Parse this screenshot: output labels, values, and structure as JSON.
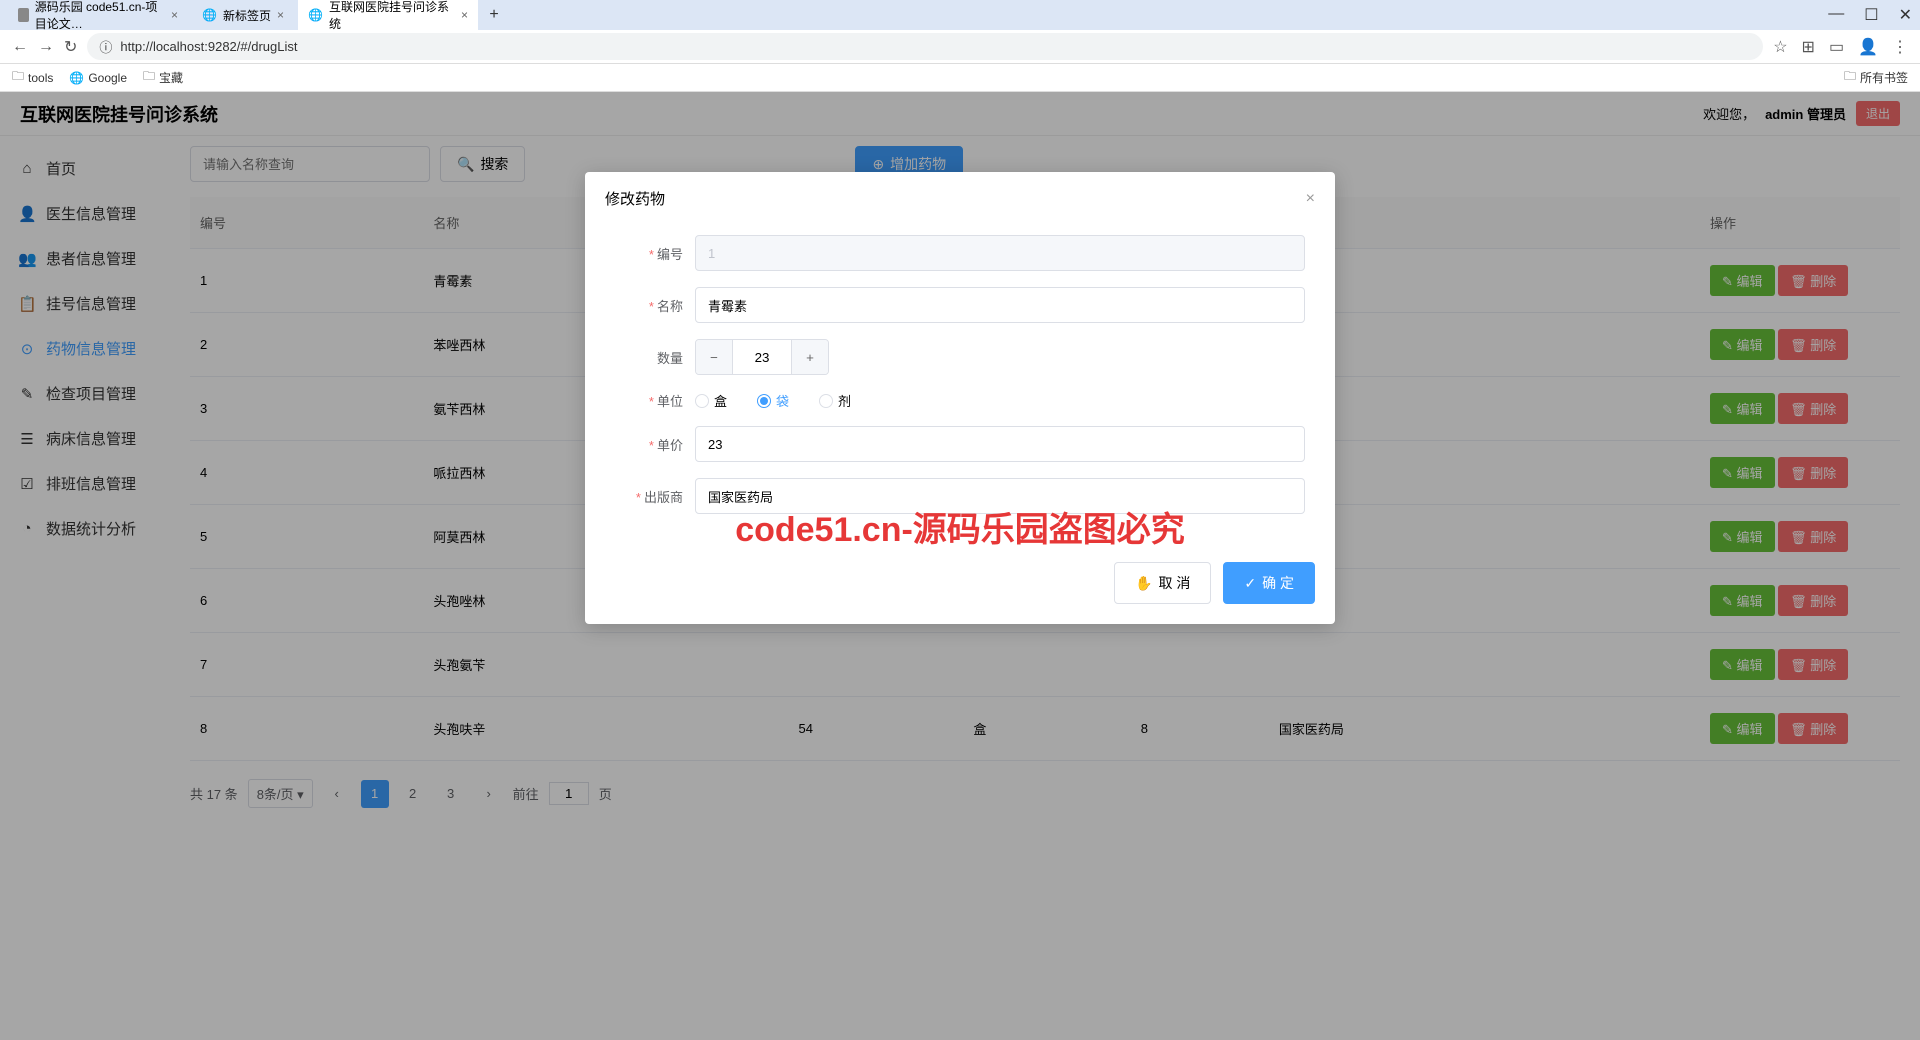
{
  "browser": {
    "tabs": [
      {
        "title": "源码乐园 code51.cn-项目论文…"
      },
      {
        "title": "新标签页"
      },
      {
        "title": "互联网医院挂号问诊系统"
      }
    ],
    "url": "http://localhost:9282/#/drugList",
    "bookmarks": [
      "tools",
      "Google",
      "宝藏"
    ],
    "all_bookmarks": "所有书签"
  },
  "header": {
    "title": "互联网医院挂号问诊系统",
    "welcome": "欢迎您，",
    "user": "admin 管理员",
    "logout": "退出"
  },
  "sidebar": {
    "items": [
      {
        "label": "首页",
        "icon": "⌂"
      },
      {
        "label": "医生信息管理",
        "icon": "👤"
      },
      {
        "label": "患者信息管理",
        "icon": "👥"
      },
      {
        "label": "挂号信息管理",
        "icon": "📋"
      },
      {
        "label": "药物信息管理",
        "icon": "⊙",
        "active": true
      },
      {
        "label": "检查项目管理",
        "icon": "✎"
      },
      {
        "label": "病床信息管理",
        "icon": "☰"
      },
      {
        "label": "排班信息管理",
        "icon": "☑"
      },
      {
        "label": "数据统计分析",
        "icon": "◔"
      }
    ]
  },
  "toolbar": {
    "search_placeholder": "请输入名称查询",
    "search_btn": "搜索",
    "add_btn": "增加药物"
  },
  "table": {
    "headers": [
      "编号",
      "名称",
      "",
      "",
      "",
      "",
      "操作"
    ],
    "edit": "编辑",
    "delete": "删除",
    "rows": [
      {
        "id": "1",
        "name": "青霉素"
      },
      {
        "id": "2",
        "name": "苯唑西林"
      },
      {
        "id": "3",
        "name": "氨苄西林"
      },
      {
        "id": "4",
        "name": "哌拉西林"
      },
      {
        "id": "5",
        "name": "阿莫西林"
      },
      {
        "id": "6",
        "name": "头孢唑林"
      },
      {
        "id": "7",
        "name": "头孢氨苄"
      },
      {
        "id": "8",
        "name": "头孢呋辛",
        "qty": "54",
        "unit": "盒",
        "price": "8",
        "publisher": "国家医药局"
      }
    ]
  },
  "pagination": {
    "total": "共 17 条",
    "per_page": "8条/页",
    "pages": [
      "1",
      "2",
      "3"
    ],
    "goto": "前往",
    "goto_val": "1",
    "page_suffix": "页"
  },
  "modal": {
    "title": "修改药物",
    "labels": {
      "id": "编号",
      "name": "名称",
      "qty": "数量",
      "unit": "单位",
      "price": "单价",
      "publisher": "出版商"
    },
    "values": {
      "id": "1",
      "name": "青霉素",
      "qty": "23",
      "price": "23",
      "publisher": "国家医药局"
    },
    "units": [
      "盒",
      "袋",
      "剂"
    ],
    "unit_selected": "袋",
    "cancel": "取 消",
    "confirm": "确 定"
  },
  "watermark": "code51.cn",
  "big_watermark": "code51.cn-源码乐园盗图必究"
}
